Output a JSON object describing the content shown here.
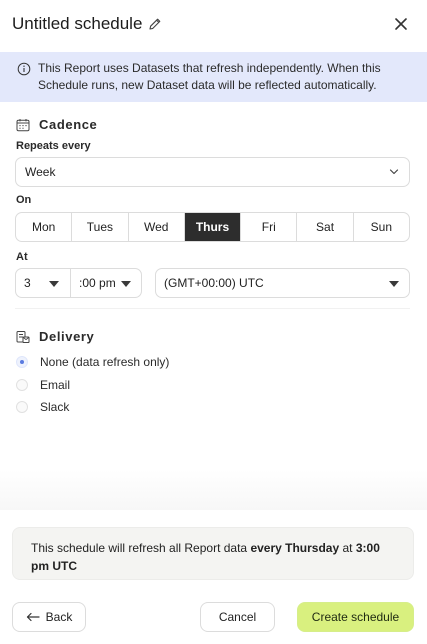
{
  "header": {
    "title": "Untitled schedule",
    "edit_icon": "pencil-icon",
    "close_icon": "close-icon"
  },
  "banner": {
    "icon": "info-icon",
    "text": "This Report uses Datasets that refresh independently. When this Schedule runs, new Dataset data will be reflected automatically.",
    "background": "#e3e8fb"
  },
  "cadence": {
    "icon": "calendar-icon",
    "title": "Cadence",
    "repeats_label": "Repeats every",
    "repeats_value": "Week",
    "on_label": "On",
    "days": [
      "Mon",
      "Tues",
      "Wed",
      "Thurs",
      "Fri",
      "Sat",
      "Sun"
    ],
    "selected_day": "Thurs",
    "at_label": "At",
    "hour": "3",
    "minute": ":00 pm",
    "timezone": "(GMT+00:00) UTC"
  },
  "delivery": {
    "icon": "delivery-icon",
    "title": "Delivery",
    "options": [
      "None (data refresh only)",
      "Email",
      "Slack"
    ],
    "selected": "None (data refresh only)",
    "accent": "#5b7be0"
  },
  "summary": {
    "prefix": "This schedule will refresh all Report data ",
    "frequency": "every Thursday",
    "middle": " at ",
    "time": "3:00 pm UTC"
  },
  "footer": {
    "back_label": "Back",
    "cancel_label": "Cancel",
    "create_label": "Create schedule",
    "create_color": "#d9f07f"
  }
}
